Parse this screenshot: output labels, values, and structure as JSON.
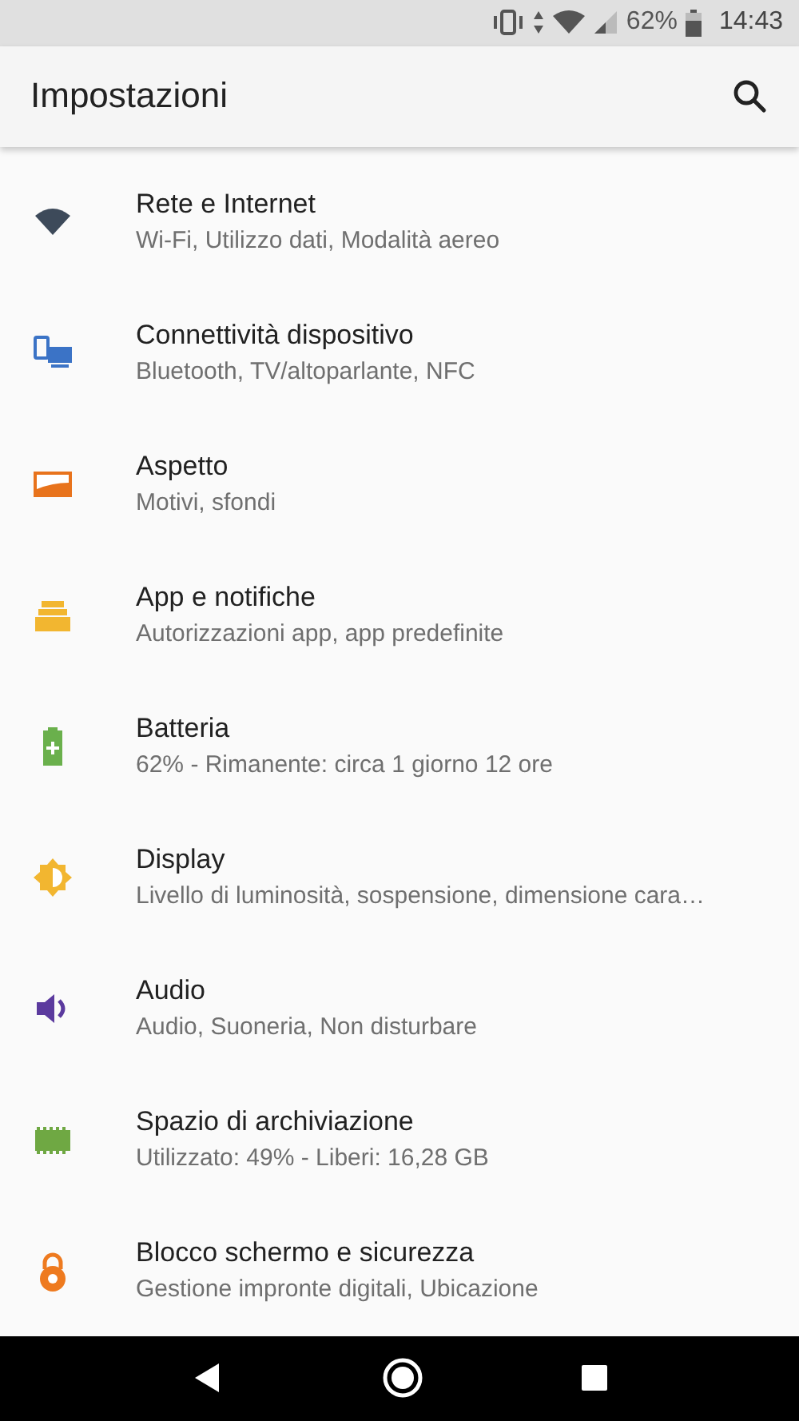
{
  "status_bar": {
    "battery": "62%",
    "time": "14:43"
  },
  "app_bar": {
    "title": "Impostazioni"
  },
  "items": [
    {
      "title": "Rete e Internet",
      "subtitle": "Wi-Fi, Utilizzo dati, Modalità aereo"
    },
    {
      "title": "Connettività dispositivo",
      "subtitle": "Bluetooth, TV/altoparlante, NFC"
    },
    {
      "title": "Aspetto",
      "subtitle": "Motivi, sfondi"
    },
    {
      "title": "App e notifiche",
      "subtitle": "Autorizzazioni app, app predefinite"
    },
    {
      "title": "Batteria",
      "subtitle": "62% - Rimanente: circa 1 giorno 12 ore"
    },
    {
      "title": "Display",
      "subtitle": "Livello di luminosità, sospensione, dimensione cara…"
    },
    {
      "title": "Audio",
      "subtitle": "Audio, Suoneria, Non disturbare"
    },
    {
      "title": "Spazio di archiviazione",
      "subtitle": "Utilizzato: 49% - Liberi: 16,28 GB"
    },
    {
      "title": "Blocco schermo e sicurezza",
      "subtitle": "Gestione impronte digitali, Ubicazione"
    }
  ]
}
